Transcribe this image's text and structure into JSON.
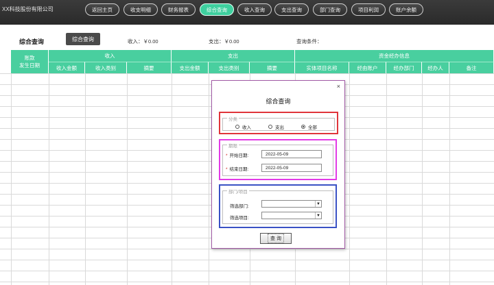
{
  "header": {
    "company": "XX科技股份有限公司",
    "nav": [
      {
        "label": "返回主页"
      },
      {
        "label": "收支明细"
      },
      {
        "label": "财务报表"
      },
      {
        "label": "综合查询"
      },
      {
        "label": "收入查询"
      },
      {
        "label": "支出查询"
      },
      {
        "label": "部门查询"
      },
      {
        "label": "项目利润"
      },
      {
        "label": "账户余额"
      }
    ],
    "active_nav": "综合查询"
  },
  "toolbar": {
    "title": "综合查询",
    "query_button": "综合查询",
    "income": "收入：￥0.00",
    "expense": "支出：￥0.00",
    "conditions": "查询条件："
  },
  "table": {
    "date_header_line1": "账款",
    "date_header_line2": "发生日期",
    "groups": {
      "income": "收入",
      "expense": "支出",
      "fund": "资金经办信息"
    },
    "columns": {
      "income_amount": "收入金额",
      "income_type": "收入类别",
      "income_summary": "摘要",
      "expense_amount": "支出金额",
      "expense_type": "支出类别",
      "expense_summary": "摘要",
      "entity": "实体项目名称",
      "account": "经由账户",
      "dept": "经办部门",
      "handler": "经办人",
      "note": "备注"
    }
  },
  "dialog": {
    "close": "×",
    "title": "综合查询",
    "category_group": "分类",
    "radios": [
      {
        "label": "收入",
        "checked": false
      },
      {
        "label": "支出",
        "checked": false
      },
      {
        "label": "全部",
        "checked": true
      }
    ],
    "period_group": "期限",
    "start_label": "开始日期:",
    "start_value": "2022-05-09",
    "end_label": "结束日期:",
    "end_value": "2022-05-09",
    "req_mark": "*",
    "dept_group": "部门/项目",
    "dept_label": "筛选部门:",
    "project_label": "筛选项目:",
    "dropdown_arrow": "▼",
    "button": "查 询"
  },
  "colors": {
    "accent": "#49cf9f",
    "red_box": "#e0343a",
    "magenta_box": "#e23ae6",
    "blue_box": "#3951c4"
  }
}
